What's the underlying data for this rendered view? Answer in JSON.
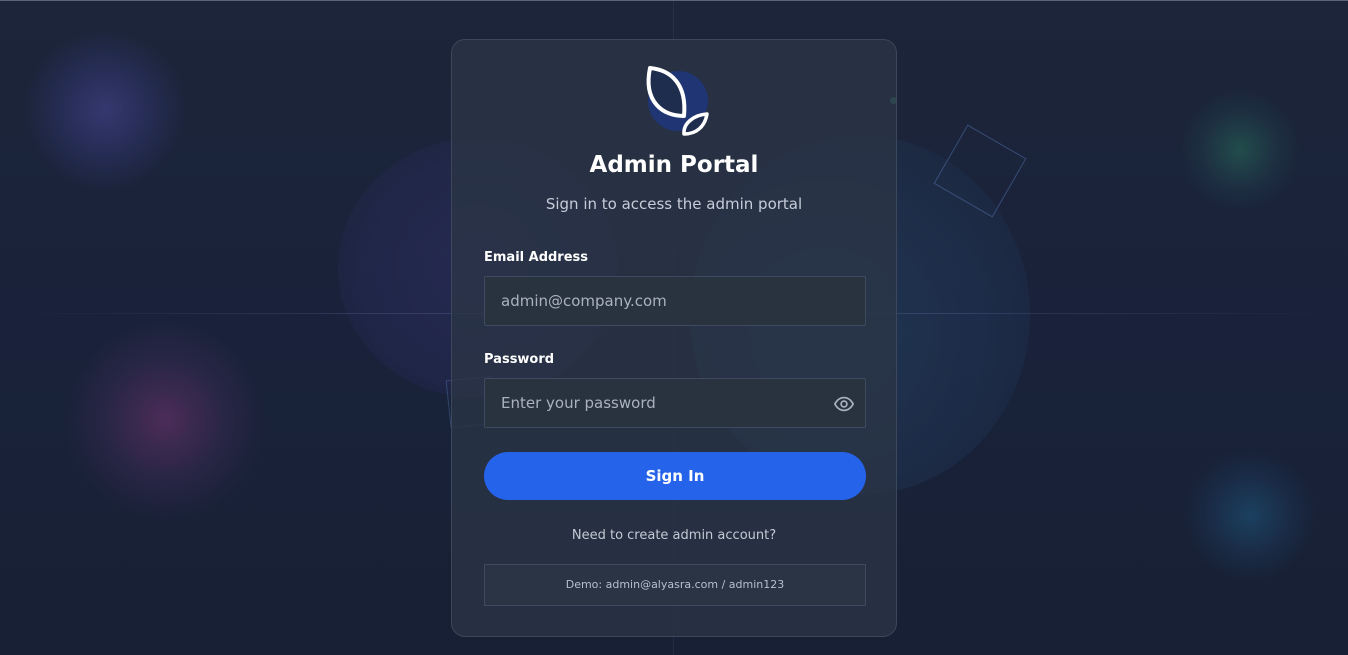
{
  "login": {
    "title": "Admin Portal",
    "subtitle": "Sign in to access the admin portal",
    "email_label": "Email Address",
    "email_placeholder": "admin@company.com",
    "password_label": "Password",
    "password_placeholder": "Enter your password",
    "sign_in_label": "Sign In",
    "create_account_link": "Need to create admin account?",
    "demo_credentials": "Demo: admin@alyasra.com / admin123"
  },
  "icons": {
    "logo": "leaf-logo-icon",
    "password_toggle": "eye-icon"
  },
  "colors": {
    "primary_button": "#2563eb",
    "background": "#1a2336",
    "card": "#2a3446"
  }
}
